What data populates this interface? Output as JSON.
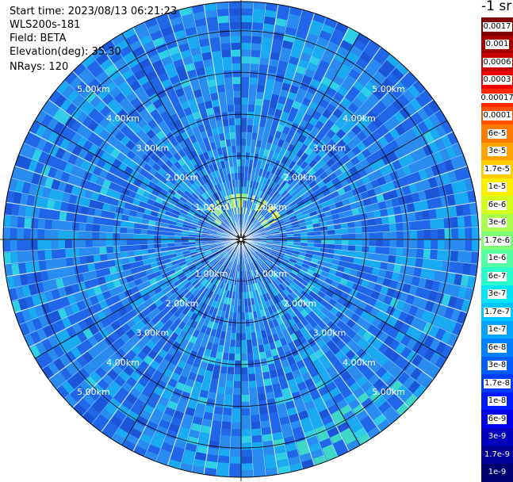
{
  "info": {
    "start_time": "Start time: 2023/08/13 06:21:23",
    "instrument": "WLS200s-181",
    "field": "Field: BETA",
    "elevation": "Elevation(deg): 35.30",
    "nrays": "NRays: 120"
  },
  "colorbar": {
    "unit": "-1 sr",
    "entries": [
      {
        "label": "0.0017",
        "color": "#800000"
      },
      {
        "label": "0.001",
        "color": "#a50000"
      },
      {
        "label": "0.0006",
        "color": "#c80000"
      },
      {
        "label": "0.0003",
        "color": "#ee0000"
      },
      {
        "label": "0.00017",
        "color": "#ff2600"
      },
      {
        "label": "0.0001",
        "color": "#ff5000"
      },
      {
        "label": "6e-5",
        "color": "#ff7a00"
      },
      {
        "label": "3e-5",
        "color": "#ffa300"
      },
      {
        "label": "1.7e-5",
        "color": "#ffcd00"
      },
      {
        "label": "1e-5",
        "color": "#ffee00"
      },
      {
        "label": "6e-6",
        "color": "#d4ff1a"
      },
      {
        "label": "3e-6",
        "color": "#aaff4d"
      },
      {
        "label": "1.7e-6",
        "color": "#7dff7a"
      },
      {
        "label": "1e-6",
        "color": "#55ffa3"
      },
      {
        "label": "6e-7",
        "color": "#2affcc"
      },
      {
        "label": "3e-7",
        "color": "#00e5f5"
      },
      {
        "label": "1.7e-7",
        "color": "#00c4ff"
      },
      {
        "label": "1e-7",
        "color": "#00a3ff"
      },
      {
        "label": "6e-8",
        "color": "#0080ff"
      },
      {
        "label": "3e-8",
        "color": "#005eff"
      },
      {
        "label": "1.7e-8",
        "color": "#003cff"
      },
      {
        "label": "1e-8",
        "color": "#001aff"
      },
      {
        "label": "6e-9",
        "color": "#0000e8"
      },
      {
        "label": "3e-9",
        "color": "#0000bf"
      },
      {
        "label": "1.7e-9",
        "color": "#000096"
      },
      {
        "label": "1e-9",
        "color": "#000070"
      }
    ]
  },
  "rings": [
    {
      "km": 1,
      "label": "1.00km"
    },
    {
      "km": 2,
      "label": "2.00km"
    },
    {
      "km": 3,
      "label": "3.00km"
    },
    {
      "km": 4,
      "label": "4.00km"
    },
    {
      "km": 5,
      "label": "5.00km"
    }
  ],
  "max_range_km": 5.7,
  "palette": [
    "#1f66e8",
    "#2a8cf0",
    "#19aaf2",
    "#2fd0e6",
    "#1b55d8",
    "#3fd8c8",
    "#8ee88a",
    "#d8ee55"
  ]
}
